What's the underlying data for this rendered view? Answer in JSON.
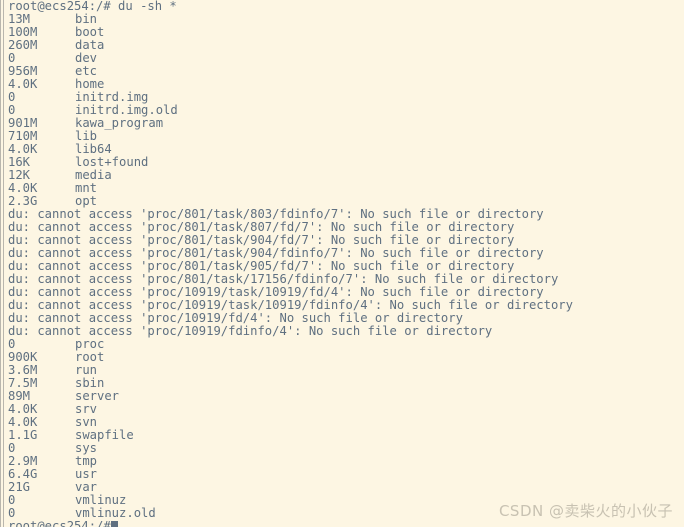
{
  "terminal": {
    "colors": {
      "background": "#fdf6e3",
      "foreground": "#5f7081",
      "frame_rule": "#b9b6ad",
      "watermark": "#c8c2b2"
    },
    "prompt_top": "root@ecs254:/# du -sh *",
    "prompt_bottom": "root@ecs254:/#",
    "entries": [
      {
        "size": "13M",
        "name": "bin"
      },
      {
        "size": "100M",
        "name": "boot"
      },
      {
        "size": "260M",
        "name": "data"
      },
      {
        "size": "0",
        "name": "dev"
      },
      {
        "size": "956M",
        "name": "etc"
      },
      {
        "size": "4.0K",
        "name": "home"
      },
      {
        "size": "0",
        "name": "initrd.img"
      },
      {
        "size": "0",
        "name": "initrd.img.old"
      },
      {
        "size": "901M",
        "name": "kawa_program"
      },
      {
        "size": "710M",
        "name": "lib"
      },
      {
        "size": "4.0K",
        "name": "lib64"
      },
      {
        "size": "16K",
        "name": "lost+found"
      },
      {
        "size": "12K",
        "name": "media"
      },
      {
        "size": "4.0K",
        "name": "mnt"
      },
      {
        "size": "2.3G",
        "name": "opt"
      }
    ],
    "errors": [
      "du: cannot access 'proc/801/task/803/fdinfo/7': No such file or directory",
      "du: cannot access 'proc/801/task/807/fd/7': No such file or directory",
      "du: cannot access 'proc/801/task/904/fd/7': No such file or directory",
      "du: cannot access 'proc/801/task/904/fdinfo/7': No such file or directory",
      "du: cannot access 'proc/801/task/905/fd/7': No such file or directory",
      "du: cannot access 'proc/801/task/17156/fdinfo/7': No such file or directory",
      "du: cannot access 'proc/10919/task/10919/fd/4': No such file or directory",
      "du: cannot access 'proc/10919/task/10919/fdinfo/4': No such file or directory",
      "du: cannot access 'proc/10919/fd/4': No such file or directory",
      "du: cannot access 'proc/10919/fdinfo/4': No such file or directory"
    ],
    "entries_after": [
      {
        "size": "0",
        "name": "proc"
      },
      {
        "size": "900K",
        "name": "root"
      },
      {
        "size": "3.6M",
        "name": "run"
      },
      {
        "size": "7.5M",
        "name": "sbin"
      },
      {
        "size": "89M",
        "name": "server"
      },
      {
        "size": "4.0K",
        "name": "srv"
      },
      {
        "size": "4.0K",
        "name": "svn"
      },
      {
        "size": "1.1G",
        "name": "swapfile"
      },
      {
        "size": "0",
        "name": "sys"
      },
      {
        "size": "2.9M",
        "name": "tmp"
      },
      {
        "size": "6.4G",
        "name": "usr"
      },
      {
        "size": "21G",
        "name": "var"
      },
      {
        "size": "0",
        "name": "vmlinuz"
      },
      {
        "size": "0",
        "name": "vmlinuz.old"
      }
    ]
  },
  "watermark": {
    "text": "CSDN @卖柴火的小伙子"
  }
}
